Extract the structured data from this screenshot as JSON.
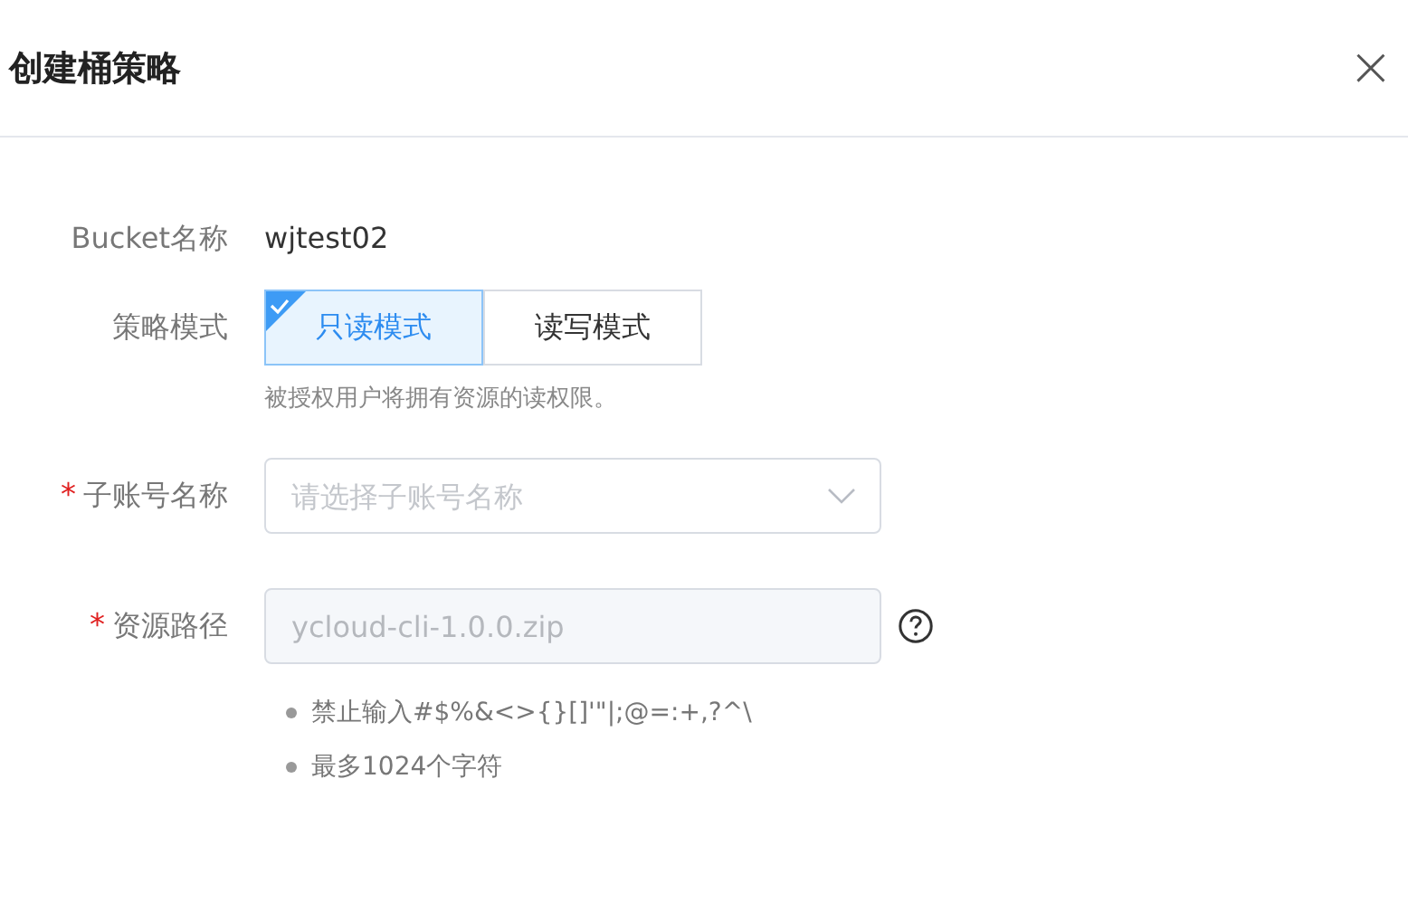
{
  "dialog": {
    "title": "创建桶策略",
    "close": "×"
  },
  "form": [
    {
      "kind": "text",
      "label": "Bucket名称",
      "value": "wjtest02"
    },
    {
      "kind": "segmented",
      "label": "策略模式",
      "options": [
        {
          "label": "只读模式",
          "selected": true
        },
        {
          "label": "读写模式",
          "selected": false
        }
      ],
      "hint": "被授权用户将拥有资源的读权限。"
    },
    {
      "kind": "select",
      "label": "子账号名称",
      "required_mark": "*",
      "placeholder": "请选择子账号名称"
    },
    {
      "kind": "input",
      "label": "资源路径",
      "required_mark": "*",
      "value": "ycloud-cli-1.0.0.zip",
      "disabled": true,
      "help": true,
      "rules": [
        "禁止输入#$%&<>{}[]'\"|;@=:+,?^\\",
        "最多1024个字符"
      ]
    }
  ]
}
